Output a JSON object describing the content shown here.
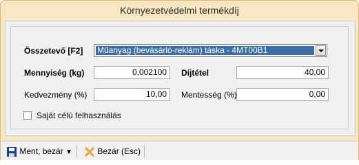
{
  "window": {
    "title": "Környezetvédelmi termékdíj"
  },
  "form": {
    "component_label": "Összetevő [F2]",
    "component_value": "Műanyag (bevásárló-reklám) táska - 4MT00B1",
    "quantity_label": "Mennyiség (kg)",
    "quantity_value": "0,002100",
    "rate_label": "Díjtétel",
    "rate_value": "40,00",
    "discount_label": "Kedvezmény (%)",
    "discount_value": "10,00",
    "exemption_label": "Mentesség (%)",
    "exemption_value": "0,00",
    "own_use_label": "Saját célú felhasználás",
    "own_use_checked": false
  },
  "toolbar": {
    "save_close_label": "Ment, bezár",
    "close_label": "Bezár (Esc)"
  },
  "colors": {
    "selection": "#3a6ea5",
    "titlebar": "#f8e7c0"
  }
}
